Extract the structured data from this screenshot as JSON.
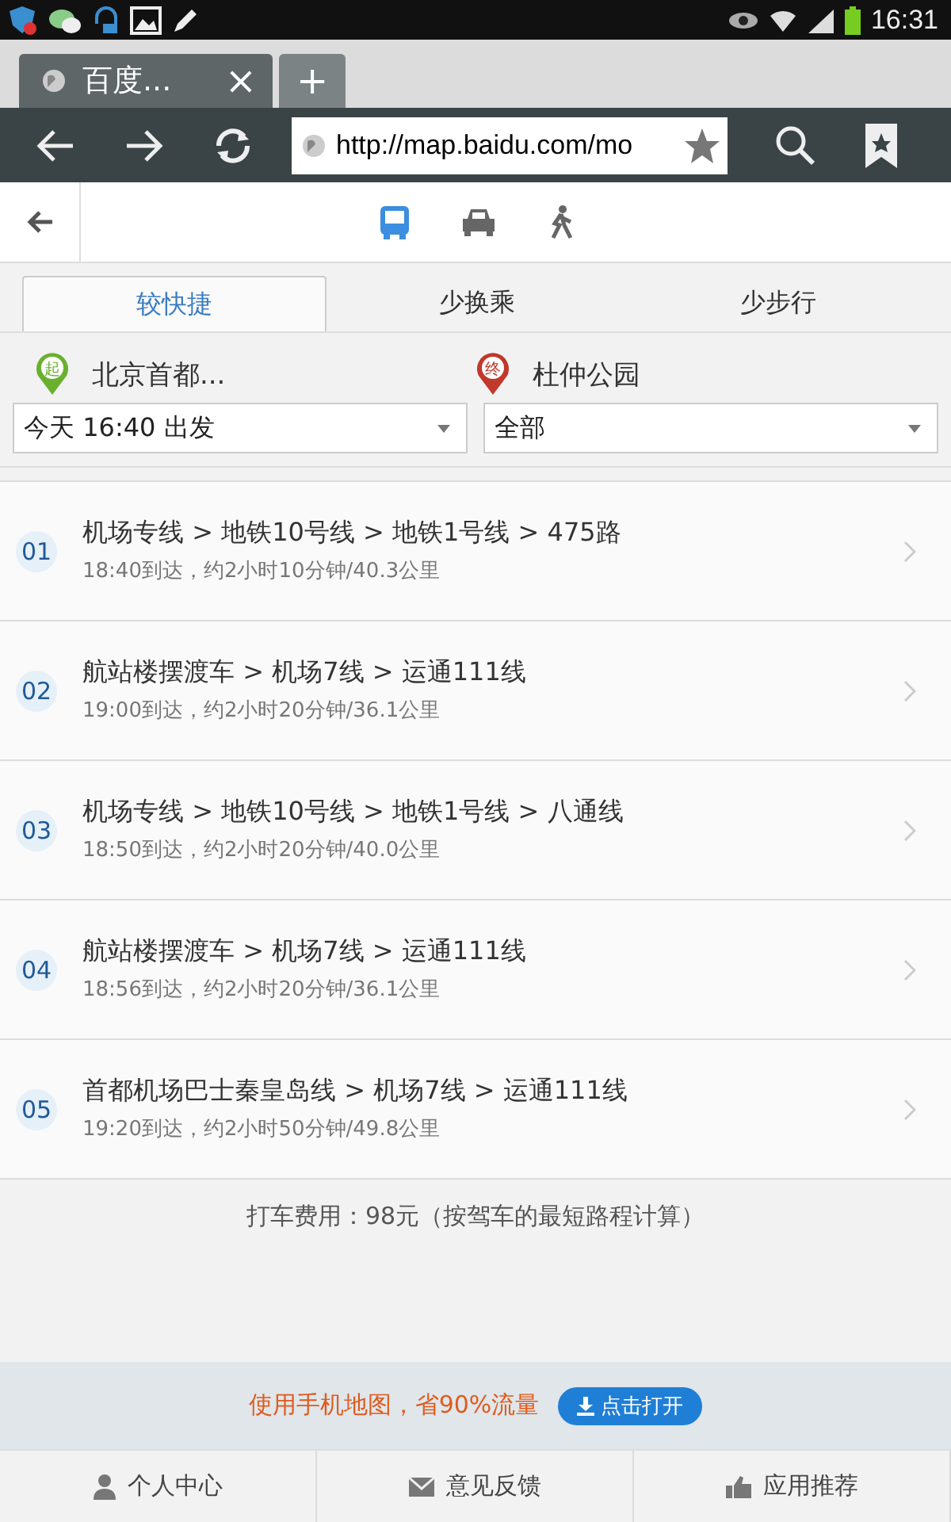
{
  "status_bar": {
    "time": "16:31"
  },
  "browser": {
    "tab_title": "百度...",
    "new_tab": "+",
    "close": "×",
    "url": "http://map.baidu.com/mo"
  },
  "modes": [
    {
      "kind": "bus",
      "selected": true
    },
    {
      "kind": "car",
      "selected": false
    },
    {
      "kind": "walk",
      "selected": false
    }
  ],
  "tabs": [
    {
      "label": "较快捷",
      "selected": true
    },
    {
      "label": "少换乘",
      "selected": false
    },
    {
      "label": "少步行",
      "selected": false
    }
  ],
  "start": {
    "badge": "起",
    "name": "北京首都..."
  },
  "end": {
    "badge": "终",
    "name": "杜仲公园"
  },
  "time_select": {
    "value": "今天 16:40 出发"
  },
  "type_select": {
    "value": "全部"
  },
  "routes": [
    {
      "index": "01",
      "lines": "机场专线 > 地铁10号线 > 地铁1号线 > 475路",
      "detail": "18:40到达，约2小时10分钟/40.3公里"
    },
    {
      "index": "02",
      "lines": "航站楼摆渡车 > 机场7线 > 运通111线",
      "detail": "19:00到达，约2小时20分钟/36.1公里"
    },
    {
      "index": "03",
      "lines": "机场专线 > 地铁10号线 > 地铁1号线 > 八通线",
      "detail": "18:50到达，约2小时20分钟/40.0公里"
    },
    {
      "index": "04",
      "lines": "航站楼摆渡车 > 机场7线 > 运通111线",
      "detail": "18:56到达，约2小时20分钟/36.1公里"
    },
    {
      "index": "05",
      "lines": "首都机场巴士秦皇岛线 > 机场7线 > 运通111线",
      "detail": "19:20到达，约2小时50分钟/49.8公里"
    }
  ],
  "taxi_note": "打车费用：98元（按驾车的最短路程计算）",
  "banner": {
    "text": "使用手机地图，省90%流量",
    "button": "点击打开"
  },
  "bottom_nav": [
    {
      "kind": "person",
      "label": "个人中心"
    },
    {
      "kind": "mail",
      "label": "意见反馈"
    },
    {
      "kind": "apps",
      "label": "应用推荐"
    }
  ]
}
